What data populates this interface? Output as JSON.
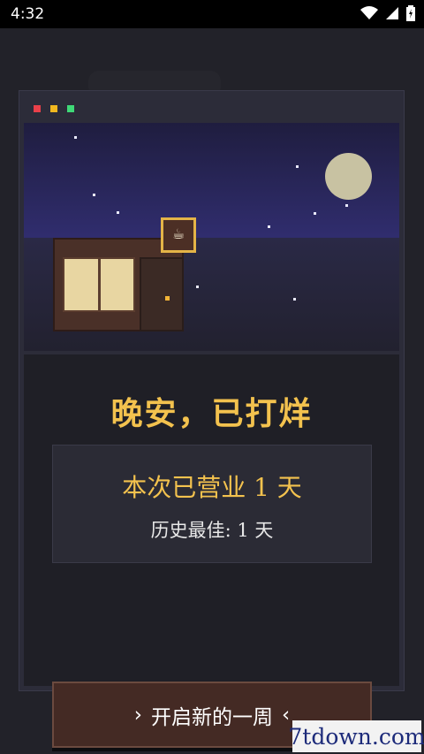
{
  "status_bar": {
    "time": "4:32"
  },
  "window": {
    "traffic_lights": [
      "red",
      "yellow",
      "green"
    ],
    "scene": {
      "moon_color": "#c8c2a2",
      "sky_color": "#302d6e",
      "sign_icon": "coffee-cup-icon"
    }
  },
  "dialog": {
    "title": "晚安，已打烊",
    "stats": {
      "current_label": "本次已营业 1 天",
      "best_label": "历史最佳: 1 天"
    },
    "button": {
      "left_arrow": "›",
      "label": "开启新的一周",
      "right_arrow": "‹"
    }
  },
  "watermark": "7tdown.com",
  "colors": {
    "accent": "#f3c24e",
    "button_bg": "#442a24"
  }
}
